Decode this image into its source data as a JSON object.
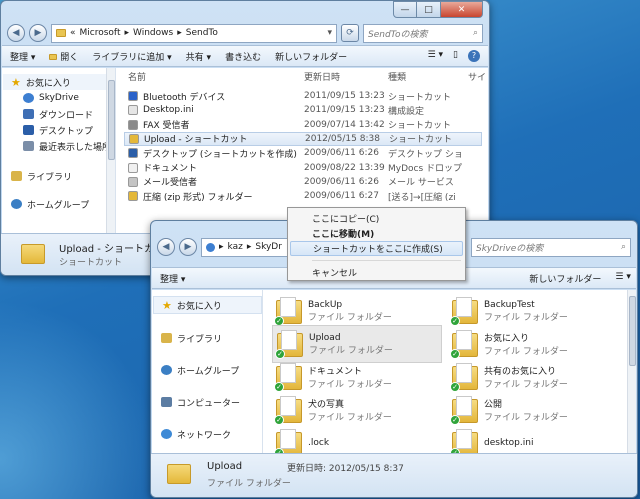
{
  "back_window": {
    "address": {
      "prefix": "«",
      "crumbs": [
        "Microsoft",
        "Windows",
        "SendTo"
      ],
      "separator": "▸"
    },
    "search_placeholder": "SendToの検索",
    "toolbar": {
      "organize": "整理 ▾",
      "open": "開く",
      "add_to_library": "ライブラリに追加 ▾",
      "share": "共有 ▾",
      "burn": "書き込む",
      "new_folder": "新しいフォルダー"
    },
    "nav": [
      "お気に入り",
      "SkyDrive",
      "ダウンロード",
      "デスクトップ",
      "最近表示した場所",
      "ライブラリ",
      "ホームグループ"
    ],
    "columns": {
      "name": "名前",
      "date": "更新日時",
      "type": "種類",
      "size": "サイ"
    },
    "files": [
      {
        "name": "Bluetooth デバイス",
        "date": "2011/09/15 13:23",
        "type": "ショートカット",
        "icon": "bluetooth-icon"
      },
      {
        "name": "Desktop.ini",
        "date": "2011/09/15 13:23",
        "type": "構成設定",
        "icon": "ini-file-icon"
      },
      {
        "name": "FAX 受信者",
        "date": "2009/07/14 13:42",
        "type": "ショートカット",
        "icon": "fax-icon"
      },
      {
        "name": "Upload - ショートカット",
        "date": "2012/05/15 8:38",
        "type": "ショートカット",
        "icon": "folder-shortcut-icon"
      },
      {
        "name": "デスクトップ (ショートカットを作成)",
        "date": "2009/06/11 6:26",
        "type": "デスクトップ ショ",
        "icon": "desktop-icon"
      },
      {
        "name": "ドキュメント",
        "date": "2009/08/22 13:39",
        "type": "MyDocs ドロップ",
        "icon": "document-icon"
      },
      {
        "name": "メール受信者",
        "date": "2009/06/11 6:26",
        "type": "メール サービス",
        "icon": "mail-icon"
      },
      {
        "name": "圧縮 (zip 形式) フォルダー",
        "date": "2009/06/11 6:27",
        "type": "[送る]→[圧縮 (zi",
        "icon": "zip-folder-icon"
      }
    ],
    "details": {
      "name": "Upload - ショートカ",
      "type": "ショートカット"
    }
  },
  "front_window": {
    "address": {
      "crumbs": [
        "kaz",
        "SkyDr"
      ],
      "separator": "▸"
    },
    "search_placeholder": "SkyDriveの検索",
    "toolbar": {
      "organize": "整理 ▾",
      "new_folder": "新しいフォルダー"
    },
    "nav": [
      "お気に入り",
      "ライブラリ",
      "ホームグループ",
      "コンピューター",
      "ネットワーク"
    ],
    "items": [
      {
        "name": "BackUp",
        "type": "ファイル フォルダー"
      },
      {
        "name": "BackupTest",
        "type": "ファイル フォルダー"
      },
      {
        "name": "Upload",
        "type": "ファイル フォルダー"
      },
      {
        "name": "お気に入り",
        "type": "ファイル フォルダー"
      },
      {
        "name": "ドキュメント",
        "type": "ファイル フォルダー"
      },
      {
        "name": "共有のお気に入り",
        "type": "ファイル フォルダー"
      },
      {
        "name": "犬の写真",
        "type": "ファイル フォルダー"
      },
      {
        "name": "公開",
        "type": "ファイル フォルダー"
      },
      {
        "name": ".lock",
        "type": ""
      },
      {
        "name": "desktop.ini",
        "type": ""
      }
    ],
    "details": {
      "name": "Upload",
      "type": "ファイル フォルダー",
      "modified": "更新日時: 2012/05/15 8:37"
    }
  },
  "context_menu": {
    "items": [
      "ここにコピー(C)",
      "ここに移動(M)",
      "ショートカットをここに作成(S)",
      "キャンセル"
    ]
  },
  "colors": {
    "desktop": "#1f6fb8",
    "selection": "#dbe8f6",
    "check": "#2fa43a"
  }
}
